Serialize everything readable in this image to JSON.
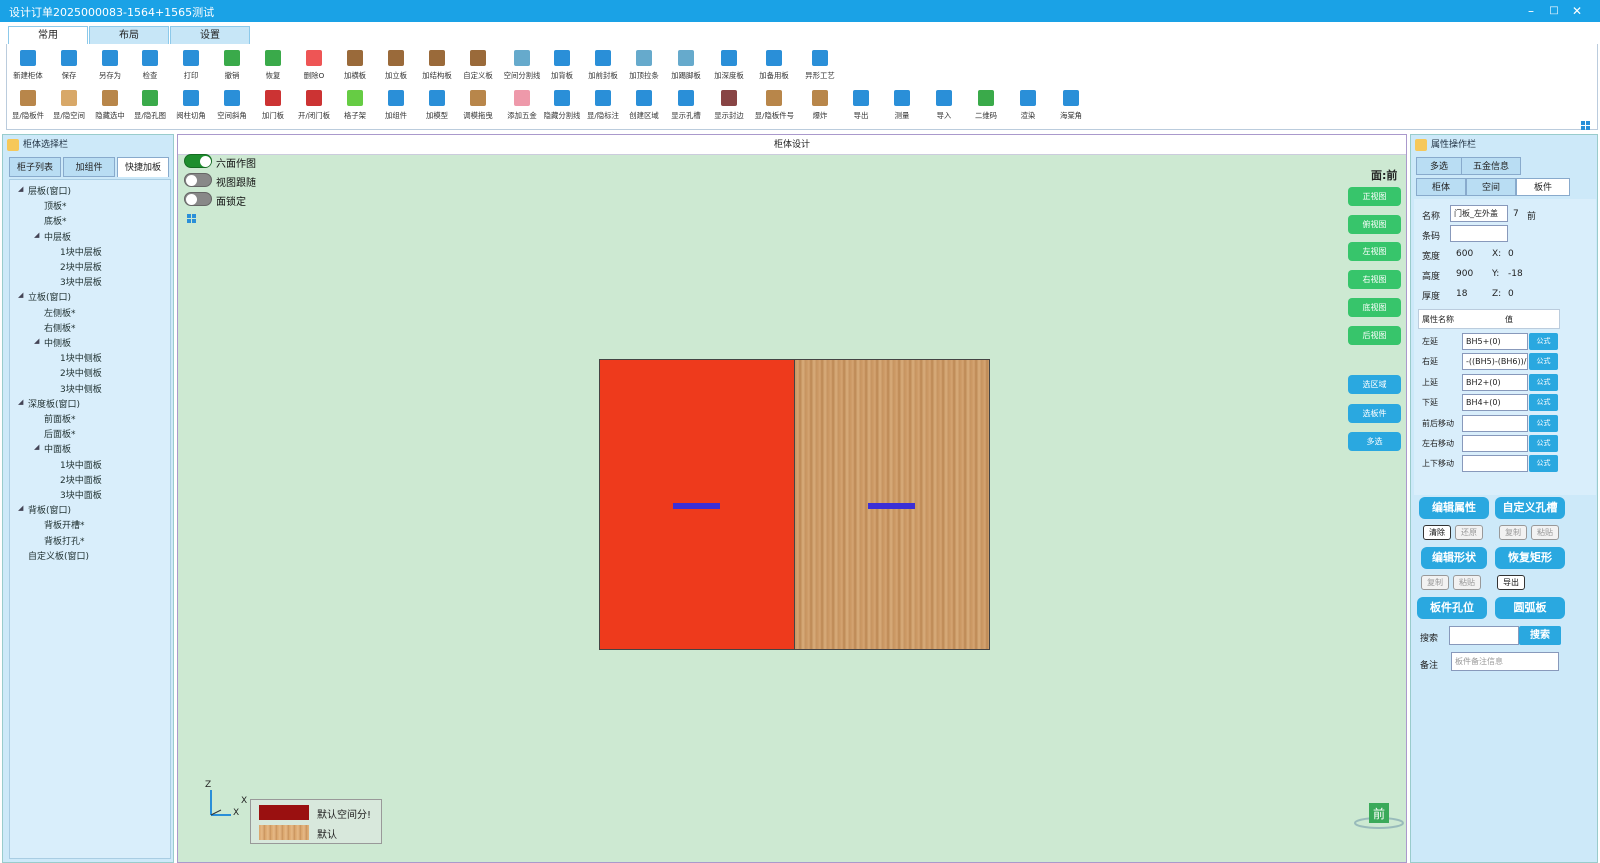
{
  "window": {
    "title": "设计订单2025000083-1564+1565测试",
    "min": "–",
    "max": "□",
    "close": "✕"
  },
  "tabs": [
    {
      "label": "常用",
      "active": true
    },
    {
      "label": "布局"
    },
    {
      "label": "设置"
    }
  ],
  "toolbar_row1": [
    {
      "label": "新建柜体",
      "color": "#2a8fd8"
    },
    {
      "label": "保存",
      "color": "#2a8fd8"
    },
    {
      "label": "另存为",
      "color": "#2a8fd8"
    },
    {
      "label": "检查",
      "color": "#2a8fd8"
    },
    {
      "label": "打印",
      "color": "#2a8fd8"
    },
    {
      "label": "撤销",
      "color": "#3aaa4a"
    },
    {
      "label": "恢复",
      "color": "#3aaa4a"
    },
    {
      "label": "删除O",
      "color": "#e55"
    },
    {
      "label": "加横板",
      "color": "#9a6a3a"
    },
    {
      "label": "加立板",
      "color": "#9a6a3a"
    },
    {
      "label": "加结构板",
      "color": "#9a6a3a"
    },
    {
      "label": "自定义板",
      "color": "#9a6a3a"
    },
    {
      "label": "空间分割线",
      "color": "#6ac"
    },
    {
      "label": "加背板",
      "color": "#2a8fd8"
    },
    {
      "label": "加前封板",
      "color": "#2a8fd8"
    },
    {
      "label": "加顶拉条",
      "color": "#6ac"
    },
    {
      "label": "加踢脚板",
      "color": "#6ac"
    },
    {
      "label": "加深度板",
      "color": "#2a8fd8"
    },
    {
      "label": "加备用板",
      "color": "#2a8fd8"
    },
    {
      "label": "异形工艺",
      "color": "#2a8fd8"
    }
  ],
  "toolbar_row2": [
    {
      "label": "显/隐板件",
      "color": "#b8864a"
    },
    {
      "label": "显/隐空间",
      "color": "#d8a868"
    },
    {
      "label": "隐藏选中",
      "color": "#b8864a"
    },
    {
      "label": "显/隐孔图",
      "color": "#3aaa4a"
    },
    {
      "label": "阅柱切角",
      "color": "#2a8fd8"
    },
    {
      "label": "空间斜角",
      "color": "#2a8fd8"
    },
    {
      "label": "加门板",
      "color": "#c33"
    },
    {
      "label": "开/闭门板",
      "color": "#c33"
    },
    {
      "label": "格子架",
      "color": "#6c4"
    },
    {
      "label": "加组件",
      "color": "#2a8fd8"
    },
    {
      "label": "加模型",
      "color": "#2a8fd8"
    },
    {
      "label": "调模拖曳",
      "color": "#b8864a"
    },
    {
      "label": "添加五金",
      "color": "#e9a"
    },
    {
      "label": "隐藏分割线",
      "color": "#2a8fd8"
    },
    {
      "label": "显/隐标注",
      "color": "#2a8fd8"
    },
    {
      "label": "创建区域",
      "color": "#2a8fd8"
    },
    {
      "label": "显示孔槽",
      "color": "#2a8fd8"
    },
    {
      "label": "显示封边",
      "color": "#844"
    },
    {
      "label": "显/隐板件号",
      "color": "#b8864a"
    },
    {
      "label": "爆炸",
      "color": "#b8864a"
    },
    {
      "label": "导出",
      "color": "#2a8fd8"
    },
    {
      "label": "测量",
      "color": "#2a8fd8"
    },
    {
      "label": "导入",
      "color": "#2a8fd8"
    },
    {
      "label": "二维码",
      "color": "#3aaa4a"
    },
    {
      "label": "渲染",
      "color": "#2a8fd8"
    },
    {
      "label": "海棠角",
      "color": "#2a8fd8"
    }
  ],
  "left_panel": {
    "title": "柜体选择栏",
    "tabs": [
      {
        "label": "柜子列表"
      },
      {
        "label": "加组件"
      },
      {
        "label": "快捷加板",
        "active": true
      }
    ],
    "tree": [
      {
        "label": "层板(窗口)",
        "level": 0,
        "open": true
      },
      {
        "label": "顶板*",
        "level": 1
      },
      {
        "label": "底板*",
        "level": 1
      },
      {
        "label": "中层板",
        "level": 1,
        "open": true
      },
      {
        "label": "1块中层板",
        "level": 2
      },
      {
        "label": "2块中层板",
        "level": 2
      },
      {
        "label": "3块中层板",
        "level": 2
      },
      {
        "label": "立板(窗口)",
        "level": 0,
        "open": true
      },
      {
        "label": "左侧板*",
        "level": 1
      },
      {
        "label": "右侧板*",
        "level": 1
      },
      {
        "label": "中侧板",
        "level": 1,
        "open": true
      },
      {
        "label": "1块中侧板",
        "level": 2
      },
      {
        "label": "2块中侧板",
        "level": 2
      },
      {
        "label": "3块中侧板",
        "level": 2
      },
      {
        "label": "深度板(窗口)",
        "level": 0,
        "open": true
      },
      {
        "label": "前面板*",
        "level": 1
      },
      {
        "label": "后面板*",
        "level": 1
      },
      {
        "label": "中面板",
        "level": 1,
        "open": true
      },
      {
        "label": "1块中面板",
        "level": 2
      },
      {
        "label": "2块中面板",
        "level": 2
      },
      {
        "label": "3块中面板",
        "level": 2
      },
      {
        "label": "背板(窗口)",
        "level": 0,
        "open": true
      },
      {
        "label": "背板开槽*",
        "level": 1
      },
      {
        "label": "背板打孔*",
        "level": 1
      },
      {
        "label": "自定义板(窗口)",
        "level": 0
      }
    ]
  },
  "center": {
    "title": "柜体设计",
    "toggles": [
      {
        "label": "六面作图",
        "on": true
      },
      {
        "label": "视图跟随",
        "on": false
      },
      {
        "label": "面锁定",
        "on": false
      }
    ],
    "face_label": "面:前",
    "view_buttons": [
      "正视图",
      "俯视图",
      "左视图",
      "右视图",
      "底视图",
      "后视图"
    ],
    "action_buttons": [
      "选区域",
      "选板件",
      "多选"
    ],
    "axis": {
      "z": "Z",
      "x": "X",
      "x2": "X"
    },
    "legend": [
      {
        "label": "默认空间分!",
        "color": "#9a1010"
      },
      {
        "label": "默认",
        "color": "#d9a46a"
      }
    ],
    "corner_face": "前",
    "panels": [
      {
        "color": "#ee3a1c"
      },
      {
        "color": "#c99560"
      }
    ],
    "handle_color": "#3b2fd6"
  },
  "right_panel": {
    "title": "属性操作栏",
    "tabs_row1": [
      {
        "label": "多选"
      },
      {
        "label": "五金信息"
      }
    ],
    "tabs_row2": [
      {
        "label": "柜体"
      },
      {
        "label": "空间"
      },
      {
        "label": "板件",
        "active": true
      }
    ],
    "name_label": "名称",
    "name_value": "门板_左外盖",
    "name_num": "7",
    "name_face": "前",
    "barcode_label": "条码",
    "dims": [
      {
        "label": "宽度",
        "value": "600",
        "axis": "X:",
        "axis_value": "0"
      },
      {
        "label": "高度",
        "value": "900",
        "axis": "Y:",
        "axis_value": "-18"
      },
      {
        "label": "厚度",
        "value": "18",
        "axis": "Z:",
        "axis_value": "0"
      }
    ],
    "prop_header": {
      "name": "属性名称",
      "value": "值"
    },
    "props": [
      {
        "label": "左延",
        "value": "BH5+(0)"
      },
      {
        "label": "右延",
        "value": "-((BH5)-(BH6))/"
      },
      {
        "label": "上延",
        "value": "BH2+(0)"
      },
      {
        "label": "下延",
        "value": "BH4+(0)"
      },
      {
        "label": "前后移动",
        "value": ""
      },
      {
        "label": "左右移动",
        "value": ""
      },
      {
        "label": "上下移动",
        "value": ""
      }
    ],
    "formula_label": "公式",
    "btn_edit_attr": "编辑属性",
    "btn_custom_hole": "自定义孔槽",
    "small1": [
      "清除",
      "还原",
      "复制",
      "粘贴"
    ],
    "btn_edit_shape": "编辑形状",
    "btn_restore_rect": "恢复矩形",
    "small2": [
      "复制",
      "粘贴",
      "导出"
    ],
    "btn_holes": "板件孔位",
    "btn_arc": "圆弧板",
    "search_label": "搜索",
    "search_button": "搜索",
    "note_label": "备注",
    "note_placeholder": "板件备注信息"
  }
}
